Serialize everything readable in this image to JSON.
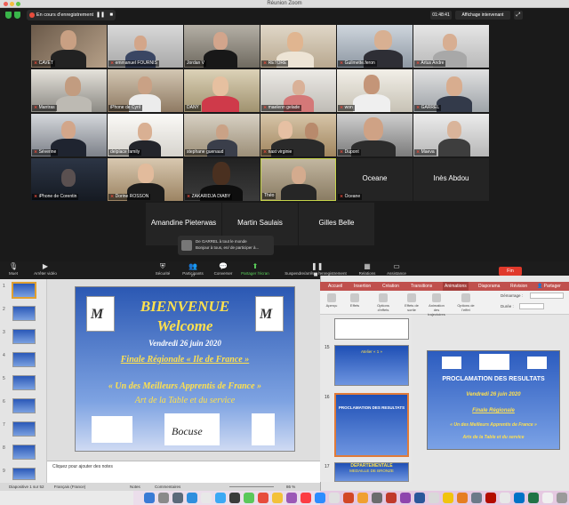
{
  "zoom": {
    "window_title": "Réunion Zoom",
    "recording_text": "En cours d'enregistrement",
    "timer": "01:48:41",
    "view_button": "Affichage intervenant",
    "participants": [
      {
        "name": "CAVET"
      },
      {
        "name": "emmanuel FOURNIS"
      },
      {
        "name": "Jordan V"
      },
      {
        "name": "RETORE"
      },
      {
        "name": "Guilmette.feron"
      },
      {
        "name": "Artus Andre"
      },
      {
        "name": "Mantras"
      },
      {
        "name": "iPhone de Cyril"
      },
      {
        "name": "DANY"
      },
      {
        "name": "maelenn gelade"
      },
      {
        "name": "won"
      },
      {
        "name": "GARREL"
      },
      {
        "name": "Séverine"
      },
      {
        "name": "delplace family"
      },
      {
        "name": "stephane guenaud"
      },
      {
        "name": "nast virginie"
      },
      {
        "name": "Dupont"
      },
      {
        "name": "Maeva"
      },
      {
        "name": "iPhone de Corentin"
      },
      {
        "name": "Dorine ROSSON"
      },
      {
        "name": "ZAKARIDJA DIABY"
      },
      {
        "name": "Théo"
      },
      {
        "name": "Oceane"
      },
      {
        "name": "Inès Abdou"
      }
    ],
    "name_tiles": [
      "Oceane",
      "Inès Abdou",
      "Amandine Pieterwas",
      "Martin Saulais",
      "Gilles Belle"
    ],
    "chat": {
      "from": "De GARREL à tout le monde",
      "message": "Bonjour à tous, en/ de participer à..."
    },
    "toolbar": {
      "mute": "Muet",
      "video": "Arrêter vidéo",
      "security": "Sécurité",
      "participants": "Participants",
      "participants_count": "27",
      "chat": "Converser",
      "share": "Partager l'écran",
      "record": "Suspendre/arrêter l'enregistrement",
      "breakout": "Relations",
      "help": "Assistance",
      "end": "Fin"
    }
  },
  "ppt_left": {
    "slide": {
      "line1": "BIENVENUE",
      "line2": "Welcome",
      "date": "Vendredi 26 juin 2020",
      "line4": "Finale Régionale « Ile de France »",
      "line5": "« Un des Meilleurs Apprentis de France »",
      "line6": "Art de la Table et du service"
    },
    "notes": "Cliquez pour ajouter des notes",
    "status": "Diapositive 1 sur 52",
    "lang": "Français (France)",
    "notes_btn": "Notes",
    "comments_btn": "Commentaires",
    "zoom_level": "86 %",
    "thumb_numbers": [
      "1",
      "2",
      "3",
      "4",
      "5",
      "6",
      "7",
      "8",
      "9"
    ]
  },
  "ppt_right": {
    "tabs": [
      "Accueil",
      "Insertion",
      "Création",
      "Transitions",
      "Animations",
      "Diaporama",
      "Révision"
    ],
    "share": "Partager",
    "ribbon": [
      "Aperçu",
      "Effets",
      "Options d'effets",
      "Effets de sortie",
      "Animation des trajectoires",
      "Options de l'effet"
    ],
    "start_label": "Démarrage :",
    "duration_label": "Durée :",
    "list_numbers": [
      "15",
      "16",
      "17"
    ],
    "mini_slides": [
      "Atelier « 1 »",
      "PROCLAMATION DES RESULTATS",
      "DEPARTEMENTALE",
      "MEDAILLE DE BRONZE"
    ],
    "slide": {
      "title": "PROCLAMATION DES RESULTATS",
      "date": "Vendredi 26 juin 2020",
      "finale": "Finale Régionale",
      "mof": "« Un des Meilleurs Apprentis de France »",
      "art": "Arts de la Table et du service"
    }
  },
  "colors": {
    "accent": "#e0392b",
    "slide_blue": "#2b58b3",
    "yellow": "#ffe14d"
  }
}
